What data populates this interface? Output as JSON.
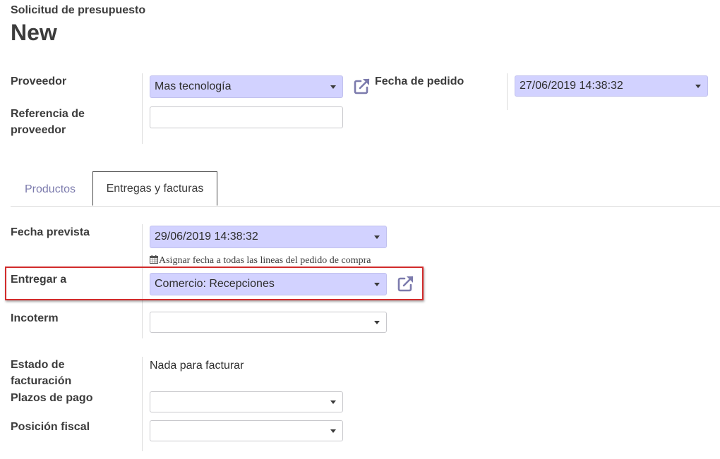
{
  "header": {
    "subtitle": "Solicitud de presupuesto",
    "title": "New"
  },
  "top_fields": {
    "vendor": {
      "label": "Proveedor",
      "value": "Mas tecnología"
    },
    "vendor_ref": {
      "label_line1": "Referencia de",
      "label_line2": "proveedor",
      "value": ""
    },
    "order_date": {
      "label": "Fecha de pedido",
      "value": "27/06/2019 14:38:32"
    }
  },
  "tabs": [
    {
      "label": "Productos",
      "active": false
    },
    {
      "label": "Entregas y facturas",
      "active": true
    }
  ],
  "delivery": {
    "scheduled_date": {
      "label": "Fecha prevista",
      "value": "29/06/2019 14:38:32"
    },
    "hint": "Asignar fecha a todas las lineas del pedido de compra",
    "deliver_to": {
      "label": "Entregar a",
      "value": "Comercio: Recepciones"
    },
    "incoterm": {
      "label": "Incoterm",
      "value": ""
    },
    "billing_status": {
      "label_line1": "Estado de",
      "label_line2": "facturación",
      "value": "Nada para facturar"
    },
    "payment_terms": {
      "label": "Plazos de pago",
      "value": ""
    },
    "fiscal_position": {
      "label": "Posición fiscal",
      "value": ""
    }
  },
  "icons": {
    "external_link": "external-link-icon",
    "calendar": "calendar-icon",
    "dropdown": "chevron-down-icon"
  },
  "colors": {
    "required_field_bg": "#d2d2ff",
    "tab_link": "#7c7bad",
    "highlight_border": "#d22b2b"
  }
}
